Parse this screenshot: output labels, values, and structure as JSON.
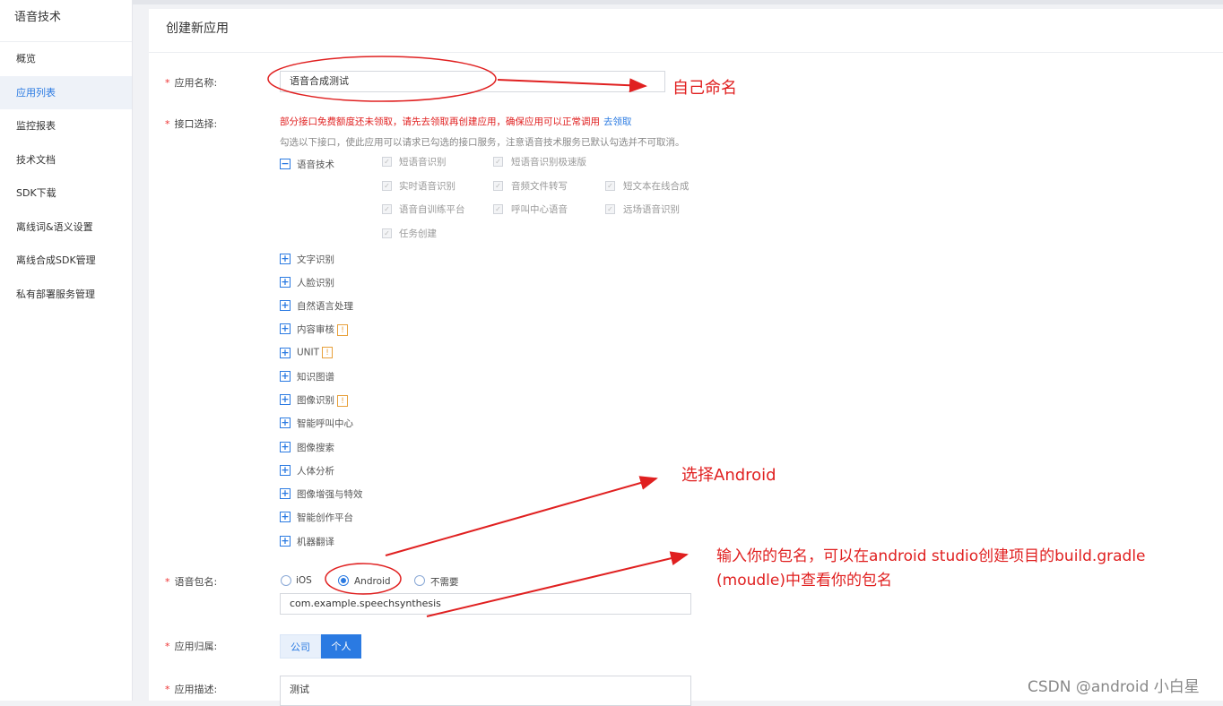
{
  "sidebar": {
    "title": "语音技术",
    "items": [
      {
        "label": "概览"
      },
      {
        "label": "应用列表"
      },
      {
        "label": "监控报表"
      },
      {
        "label": "技术文档"
      },
      {
        "label": "SDK下载"
      },
      {
        "label": "离线词&语义设置"
      },
      {
        "label": "离线合成SDK管理"
      },
      {
        "label": "私有部署服务管理"
      }
    ],
    "active_index": 1
  },
  "page": {
    "title": "创建新应用"
  },
  "form": {
    "app_name": {
      "label": "应用名称:",
      "value": "语音合成测试"
    },
    "api": {
      "label": "接口选择:",
      "notice": "部分接口免费额度还未领取，请先去领取再创建应用，确保应用可以正常调用",
      "notice_link": "去领取",
      "hint": "勾选以下接口，使此应用可以请求已勾选的接口服务，注意语音技术服务已默认勾选并不可取消。",
      "speech": {
        "label": "语音技术",
        "options": [
          "短语音识别",
          "短语音识别极速版",
          "实时语音识别",
          "音频文件转写",
          "短文本在线合成",
          "语音自训练平台",
          "呼叫中心语音",
          "远场语音识别",
          "任务创建"
        ]
      },
      "categories": [
        {
          "label": "文字识别",
          "warn": false
        },
        {
          "label": "人脸识别",
          "warn": false
        },
        {
          "label": "自然语言处理",
          "warn": false
        },
        {
          "label": "内容审核",
          "warn": true
        },
        {
          "label": "UNIT",
          "warn": true
        },
        {
          "label": "知识图谱",
          "warn": false
        },
        {
          "label": "图像识别",
          "warn": true
        },
        {
          "label": "智能呼叫中心",
          "warn": false
        },
        {
          "label": "图像搜索",
          "warn": false
        },
        {
          "label": "人体分析",
          "warn": false
        },
        {
          "label": "图像增强与特效",
          "warn": false
        },
        {
          "label": "智能创作平台",
          "warn": false
        },
        {
          "label": "机器翻译",
          "warn": false
        }
      ],
      "warn_symbol": "!"
    },
    "package": {
      "label": "语音包名:",
      "options": [
        "iOS",
        "Android",
        "不需要"
      ],
      "selected": "Android",
      "value": "com.example.speechsynthesis"
    },
    "ownership": {
      "label": "应用归属:",
      "options": [
        "公司",
        "个人"
      ],
      "selected": "个人"
    },
    "description": {
      "label": "应用描述:",
      "value": "测试"
    }
  },
  "annotations": {
    "name_note": "自己命名",
    "android_note": "选择Android",
    "package_note_line1": "输入你的包名，可以在android studio创建项目的build.gradle",
    "package_note_line2": "(moudle)中查看你的包名"
  },
  "watermark": "CSDN @android 小白星",
  "colors": {
    "accent": "#2a7ae2",
    "annotation": "#e02020",
    "notice": "#e02020"
  }
}
